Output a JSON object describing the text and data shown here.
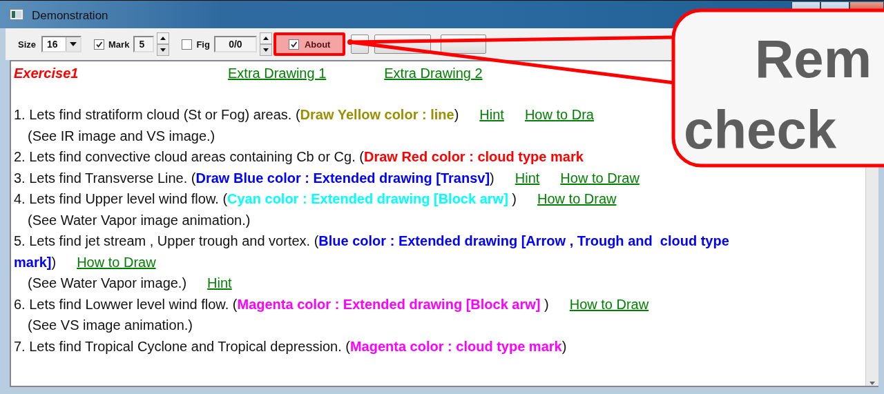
{
  "window": {
    "title": "Demonstration"
  },
  "toolbar": {
    "size": {
      "label": "Size",
      "value": "16"
    },
    "mark": {
      "label": "Mark",
      "checked": true,
      "value": "5"
    },
    "fig": {
      "label": "Fig",
      "checked": false,
      "value": "0/0"
    },
    "about": {
      "label": "About",
      "checked": true
    }
  },
  "exercise": {
    "title": "Exercise1",
    "links": [
      "Extra Drawing 1",
      "Extra Drawing 2"
    ],
    "lines": [
      {
        "kind": "step",
        "parts": [
          {
            "text": "1. Lets find stratiform cloud (St or Fog) areas. ("
          },
          {
            "text": "Draw Yellow color : line",
            "color": "#9a8f00"
          },
          {
            "text": ")"
          }
        ],
        "links": [
          "Hint",
          "How to Dra"
        ]
      },
      {
        "kind": "note",
        "parts": [
          {
            "text": "(See IR image and VS image.)"
          }
        ]
      },
      {
        "kind": "step",
        "parts": [
          {
            "text": "2. Lets find convective cloud areas containing Cb or Cg. ("
          },
          {
            "text": "Draw Red color : cloud type mark",
            "color": "#ff0000"
          }
        ]
      },
      {
        "kind": "step",
        "parts": [
          {
            "text": "3. Lets find Transverse Line. ("
          },
          {
            "text": "Draw Blue color : Extended drawing [Transv]",
            "color": "#0000ff"
          },
          {
            "text": ")"
          }
        ],
        "links": [
          "Hint",
          "How to Draw"
        ]
      },
      {
        "kind": "step",
        "parts": [
          {
            "text": "4. Lets find Upper level wind flow. ("
          },
          {
            "text": "Cyan color : Extended drawing [Block arw]",
            "color": "#00ffff"
          },
          {
            "text": " )"
          }
        ],
        "links": [
          "How to Draw"
        ]
      },
      {
        "kind": "note",
        "parts": [
          {
            "text": "(See Water Vapor image animation.)"
          }
        ]
      },
      {
        "kind": "step",
        "parts": [
          {
            "text": "5. Lets find jet stream , Upper trough and vortex. ("
          },
          {
            "text": "Blue color : Extended drawing [Arrow , Trough and  cloud type mark]",
            "color": "#0000ff"
          },
          {
            "text": ")"
          }
        ],
        "links": [
          "How to Draw"
        ]
      },
      {
        "kind": "note",
        "parts": [
          {
            "text": "(See Water Vapor image.)"
          }
        ],
        "links": [
          "Hint"
        ]
      },
      {
        "kind": "step",
        "parts": [
          {
            "text": "6. Lets find Lowwer level wind flow. ("
          },
          {
            "text": "Magenta color : Extended drawing [Block arw]",
            "color": "#ff00ff"
          },
          {
            "text": " )"
          }
        ],
        "links": [
          "How to Draw"
        ]
      },
      {
        "kind": "note",
        "parts": [
          {
            "text": "(See VS image animation.)"
          }
        ]
      },
      {
        "kind": "step",
        "parts": [
          {
            "text": "7. Lets find Tropical Cyclone and Tropical depression. ("
          },
          {
            "text": "Magenta color : cloud type mark",
            "color": "#ff00ff"
          },
          {
            "text": ")"
          }
        ]
      }
    ]
  },
  "callout": {
    "lines": [
      "Rem",
      "check"
    ]
  }
}
